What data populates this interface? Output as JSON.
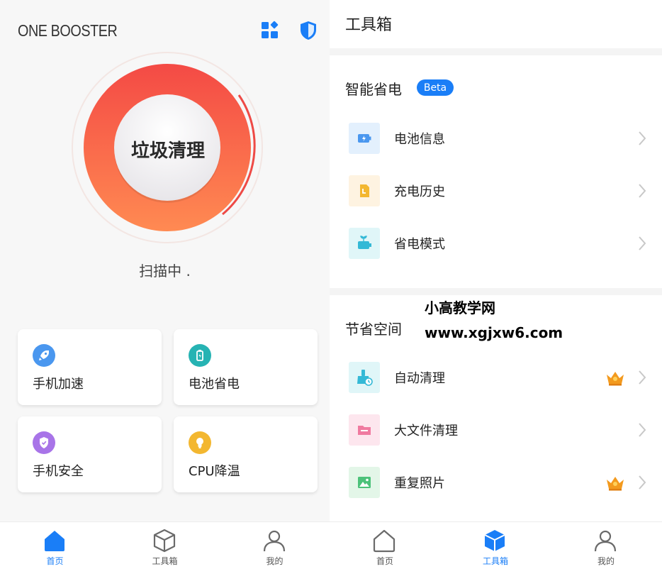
{
  "left": {
    "app_title": "ONE BOOSTER",
    "clean_button": "垃圾清理",
    "scan_status": "扫描中 .",
    "cards": [
      {
        "label": "手机加速",
        "icon": "rocket-icon",
        "color": "#4a97ef"
      },
      {
        "label": "电池省电",
        "icon": "battery-icon",
        "color": "#26b3b3"
      },
      {
        "label": "手机安全",
        "icon": "shield-icon",
        "color": "#a874e8"
      },
      {
        "label": "CPU降温",
        "icon": "thermometer-icon",
        "color": "#f3b730"
      }
    ],
    "tabs": [
      {
        "label": "首页",
        "icon": "home-icon",
        "active": true
      },
      {
        "label": "工具箱",
        "icon": "cube-icon",
        "active": false
      },
      {
        "label": "我的",
        "icon": "person-icon",
        "active": false
      }
    ]
  },
  "right": {
    "title": "工具箱",
    "power_section": {
      "title": "智能省电",
      "badge": "Beta",
      "items": [
        {
          "label": "电池信息",
          "icon": "battery-info-icon",
          "bg": "#e3f0fd",
          "fg": "#4a97ef"
        },
        {
          "label": "充电历史",
          "icon": "charge-history-icon",
          "bg": "#fef3e1",
          "fg": "#f3b730"
        },
        {
          "label": "省电模式",
          "icon": "power-saving-icon",
          "bg": "#e0f6f8",
          "fg": "#34b9d6"
        }
      ]
    },
    "space_section": {
      "title": "节省空间",
      "items": [
        {
          "label": "自动清理",
          "icon": "auto-clean-icon",
          "bg": "#e0f6f8",
          "fg": "#34b9d6",
          "crown": true
        },
        {
          "label": "大文件清理",
          "icon": "folder-icon",
          "bg": "#fde6ee",
          "fg": "#f07aa0",
          "crown": false
        },
        {
          "label": "重复照片",
          "icon": "photo-icon",
          "bg": "#e3f6e8",
          "fg": "#4cc27a",
          "crown": true
        }
      ]
    },
    "watermark": {
      "line1": "小高教学网",
      "line2": "www.xgjxw6.com"
    },
    "tabs": [
      {
        "label": "首页",
        "icon": "home-icon",
        "active": false
      },
      {
        "label": "工具箱",
        "icon": "cube-icon",
        "active": true
      },
      {
        "label": "我的",
        "icon": "person-icon",
        "active": false
      }
    ]
  },
  "colors": {
    "accent": "#1a7ef7",
    "gauge_top": "#f44a45",
    "gauge_bottom": "#ff8a52",
    "crown": "#f39a1e"
  }
}
